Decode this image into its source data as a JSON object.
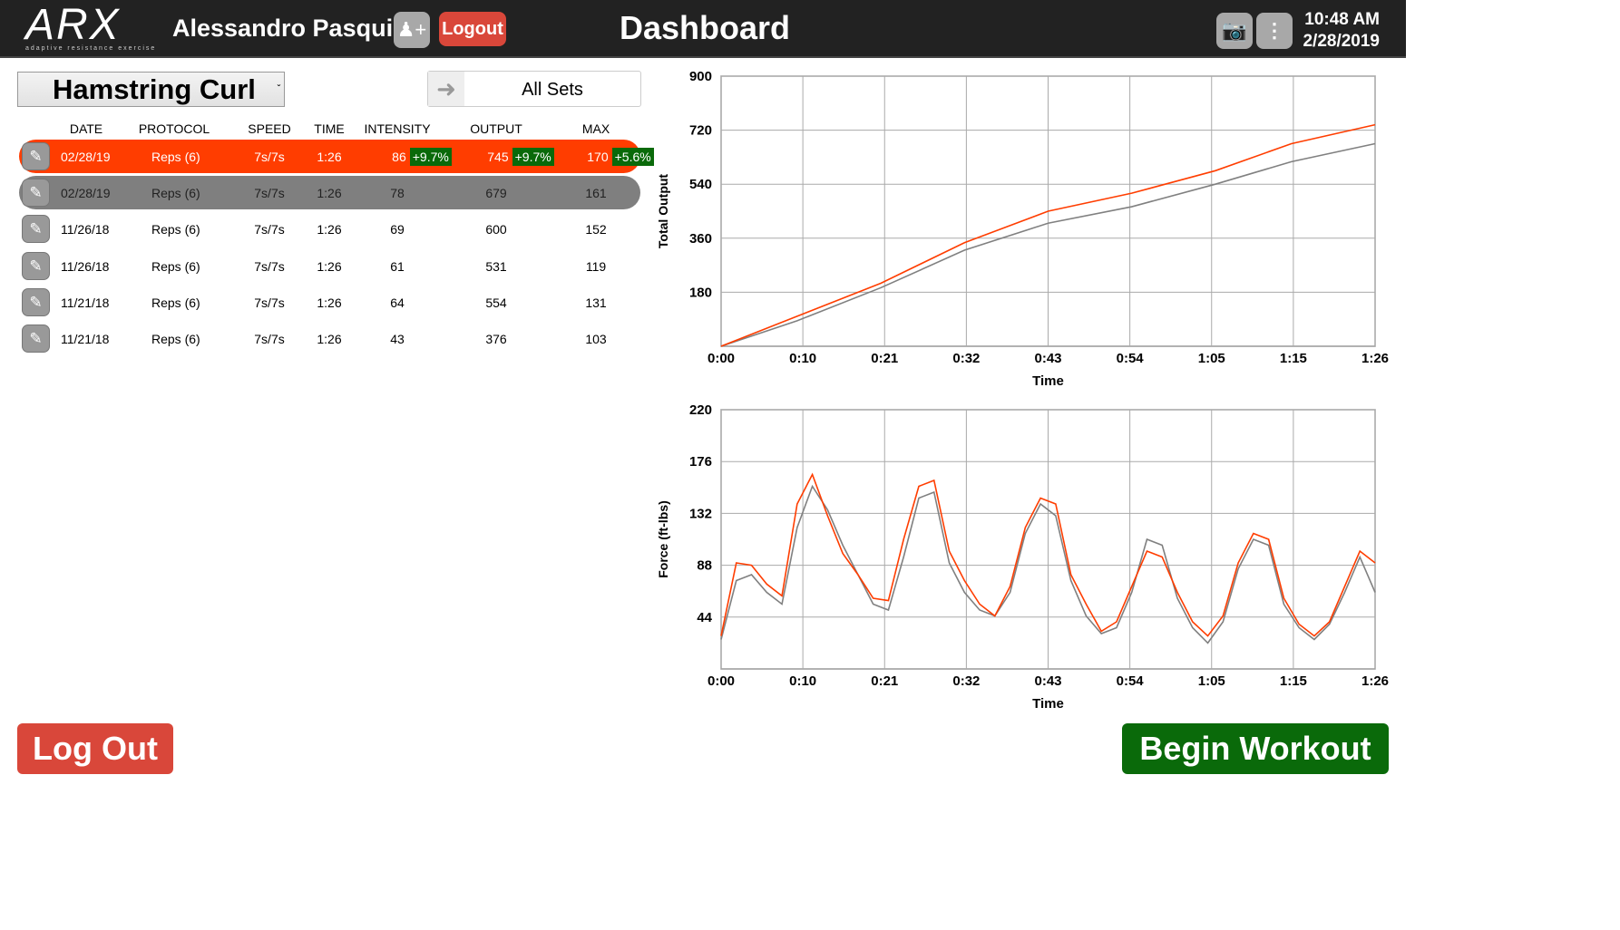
{
  "header": {
    "logo_text": "ARX",
    "logo_tagline": "adaptive resistance exercise",
    "user_name": "Alessandro Pasquini",
    "add_user_icon": "user-plus-icon",
    "logout_label": "Logout",
    "title": "Dashboard",
    "camera_icon": "camera-icon",
    "menu_icon": "kebab-menu-icon",
    "time": "10:48 AM",
    "date": "2/28/2019"
  },
  "controls": {
    "exercise": "Hamstring Curl",
    "sets_filter": "All Sets"
  },
  "table": {
    "columns": [
      "DATE",
      "PROTOCOL",
      "SPEED",
      "TIME",
      "INTENSITY",
      "OUTPUT",
      "MAX"
    ],
    "rows": [
      {
        "date": "02/28/19",
        "protocol": "Reps (6)",
        "speed": "7s/7s",
        "time": "1:26",
        "intensity": "86",
        "intensity_delta": "+9.7%",
        "output": "745",
        "output_delta": "+9.7%",
        "max": "170",
        "max_delta": "+5.6%"
      },
      {
        "date": "02/28/19",
        "protocol": "Reps (6)",
        "speed": "7s/7s",
        "time": "1:26",
        "intensity": "78",
        "output": "679",
        "max": "161"
      },
      {
        "date": "11/26/18",
        "protocol": "Reps (6)",
        "speed": "7s/7s",
        "time": "1:26",
        "intensity": "69",
        "output": "600",
        "max": "152"
      },
      {
        "date": "11/26/18",
        "protocol": "Reps (6)",
        "speed": "7s/7s",
        "time": "1:26",
        "intensity": "61",
        "output": "531",
        "max": "119"
      },
      {
        "date": "11/21/18",
        "protocol": "Reps (6)",
        "speed": "7s/7s",
        "time": "1:26",
        "intensity": "64",
        "output": "554",
        "max": "131"
      },
      {
        "date": "11/21/18",
        "protocol": "Reps (6)",
        "speed": "7s/7s",
        "time": "1:26",
        "intensity": "43",
        "output": "376",
        "max": "103"
      }
    ]
  },
  "buttons": {
    "log_out": "Log Out",
    "begin_workout": "Begin Workout"
  },
  "colors": {
    "current": "#ff3d00",
    "previous": "#808080",
    "positive": "#0a6a0a",
    "logout": "#d9473a",
    "begin": "#0a6a0a"
  },
  "chart_data": [
    {
      "type": "line",
      "xlabel": "Time",
      "ylabel": "Total Output",
      "xlim": [
        0,
        86
      ],
      "ylim": [
        0,
        900
      ],
      "grid": true,
      "xticks": [
        "0:00",
        "0:10",
        "0:21",
        "0:32",
        "0:43",
        "0:54",
        "1:05",
        "1:15",
        "1:26"
      ],
      "yticks": [
        "180",
        "360",
        "540",
        "720",
        "900"
      ],
      "x": [
        0,
        10,
        21,
        32,
        43,
        54,
        65,
        75,
        86
      ],
      "series": [
        {
          "color": "#ff3d00",
          "values": [
            0,
            100,
            210,
            345,
            450,
            510,
            585,
            675,
            738
          ]
        },
        {
          "color": "#808080",
          "values": [
            0,
            85,
            195,
            320,
            410,
            465,
            540,
            615,
            675
          ]
        }
      ]
    },
    {
      "type": "line",
      "xlabel": "Time",
      "ylabel": "Force (ft-lbs)",
      "xlim": [
        0,
        86
      ],
      "ylim": [
        0,
        220
      ],
      "grid": true,
      "xticks": [
        "0:00",
        "0:10",
        "0:21",
        "0:32",
        "0:43",
        "0:54",
        "1:05",
        "1:15",
        "1:26"
      ],
      "yticks": [
        "44",
        "88",
        "132",
        "176",
        "220"
      ],
      "x": [
        0,
        2,
        4,
        6,
        8,
        10,
        12,
        14,
        16,
        18,
        20,
        22,
        24,
        26,
        28,
        30,
        32,
        34,
        36,
        38,
        40,
        42,
        44,
        46,
        48,
        50,
        52,
        54,
        56,
        58,
        60,
        62,
        64,
        66,
        68,
        70,
        72,
        74,
        76,
        78,
        80,
        82,
        84,
        86
      ],
      "series": [
        {
          "color": "#ff3d00",
          "values": [
            28,
            90,
            88,
            72,
            62,
            140,
            165,
            130,
            98,
            80,
            60,
            58,
            110,
            155,
            160,
            100,
            75,
            55,
            45,
            70,
            120,
            145,
            140,
            80,
            55,
            32,
            40,
            70,
            100,
            95,
            65,
            40,
            28,
            45,
            90,
            115,
            110,
            60,
            38,
            28,
            40,
            70,
            100,
            90
          ]
        },
        {
          "color": "#808080",
          "values": [
            25,
            75,
            80,
            65,
            55,
            120,
            155,
            135,
            105,
            80,
            55,
            50,
            95,
            145,
            150,
            90,
            65,
            50,
            45,
            65,
            115,
            140,
            130,
            75,
            45,
            30,
            35,
            65,
            110,
            105,
            60,
            35,
            22,
            40,
            85,
            110,
            105,
            55,
            35,
            25,
            38,
            65,
            95,
            65
          ]
        }
      ]
    }
  ]
}
